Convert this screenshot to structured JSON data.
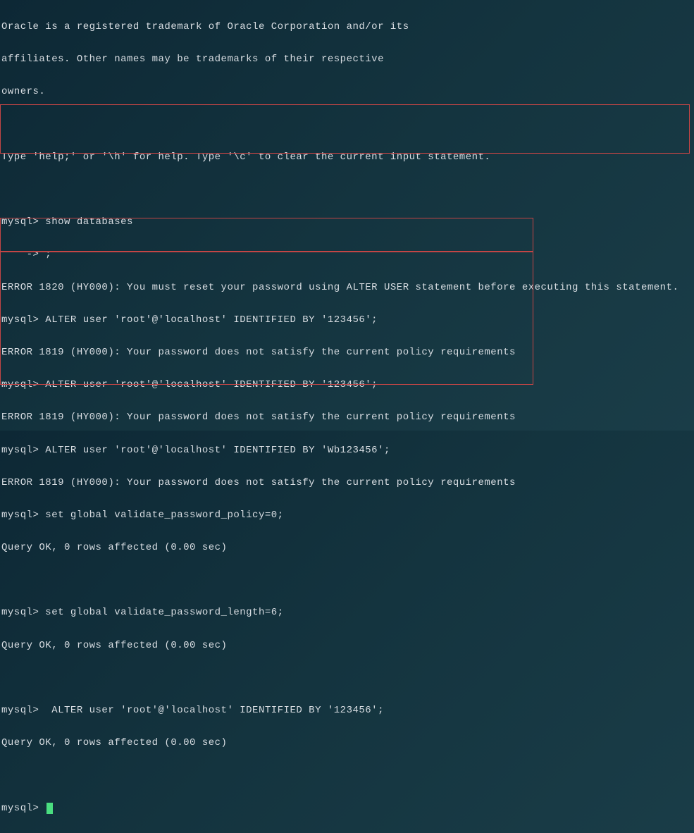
{
  "intro": {
    "line1": "Oracle is a registered trademark of Oracle Corporation and/or its",
    "line2": "affiliates. Other names may be trademarks of their respective",
    "line3": "owners.",
    "help": "Type 'help;' or '\\h' for help. Type '\\c' to clear the current input statement."
  },
  "block1": {
    "l1": "mysql> show databases",
    "l2": "    -> ;",
    "l3": "ERROR 1820 (HY000): You must reset your password using ALTER USER statement before executing this statement."
  },
  "block2": {
    "l1": "mysql> ALTER user 'root'@'localhost' IDENTIFIED BY '123456';",
    "l2": "ERROR 1819 (HY000): Your password does not satisfy the current policy requirements",
    "l3": "mysql> ALTER user 'root'@'localhost' IDENTIFIED BY '123456';",
    "l4": "ERROR 1819 (HY000): Your password does not satisfy the current policy requirements"
  },
  "block3": {
    "l1": "mysql> ALTER user 'root'@'localhost' IDENTIFIED BY 'Wb123456';",
    "l2": "ERROR 1819 (HY000): Your password does not satisfy the current policy requirements"
  },
  "block4": {
    "l1": "mysql> set global validate_password_policy=0;",
    "l2": "Query OK, 0 rows affected (0.00 sec)",
    "l3": "",
    "l4": "mysql> set global validate_password_length=6;",
    "l5": "Query OK, 0 rows affected (0.00 sec)",
    "l6": "",
    "l7": "mysql>  ALTER user 'root'@'localhost' IDENTIFIED BY '123456';",
    "l8": "Query OK, 0 rows affected (0.00 sec)"
  },
  "prompt": {
    "text": "mysql> "
  }
}
